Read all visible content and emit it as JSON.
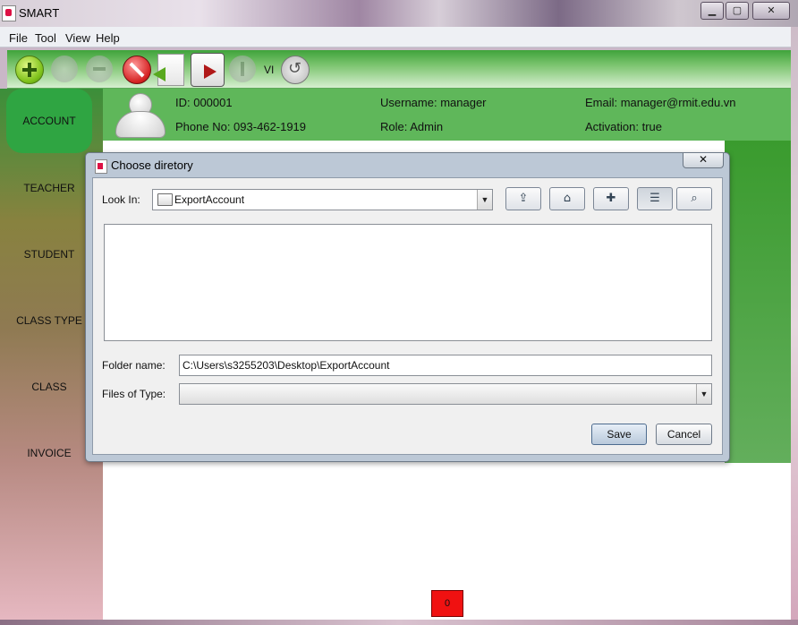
{
  "window": {
    "title": "SMART",
    "controls": {
      "minimize": "▁",
      "maximize": "▢",
      "close": "✕"
    }
  },
  "menu": [
    "File",
    "Tool",
    "View",
    "Help"
  ],
  "toolbar": {
    "language": "VI"
  },
  "sidebar": {
    "items": [
      "ACCOUNT",
      "TEACHER",
      "STUDENT",
      "CLASS TYPE",
      "CLASS",
      "INVOICE"
    ],
    "active": "ACCOUNT"
  },
  "account": {
    "id": "ID: 000001",
    "phone": "Phone No: 093-462-1919",
    "username": "Username: manager",
    "role": "Role: Admin",
    "email": "Email: manager@rmit.edu.vn",
    "activation": "Activation: true"
  },
  "dialog": {
    "title": "Choose diretory",
    "close": "✕",
    "look_in_label": "Look In:",
    "look_in_value": "ExportAccount",
    "folder_name_label": "Folder name:",
    "folder_name_value": "C:\\Users\\s3255203\\Desktop\\ExportAccount",
    "files_of_type_label": "Files of Type:",
    "files_of_type_value": "",
    "save_label": "Save",
    "cancel_label": "Cancel",
    "toolbar_icons": [
      "up-one-level-icon",
      "home-icon",
      "new-folder-icon",
      "list-view-icon",
      "details-view-icon"
    ]
  },
  "status": {
    "counter": "0"
  },
  "colors": {
    "accent_green": "#5fb75a",
    "sidebar_active": "#2fa542",
    "counter_red": "#f01111"
  }
}
